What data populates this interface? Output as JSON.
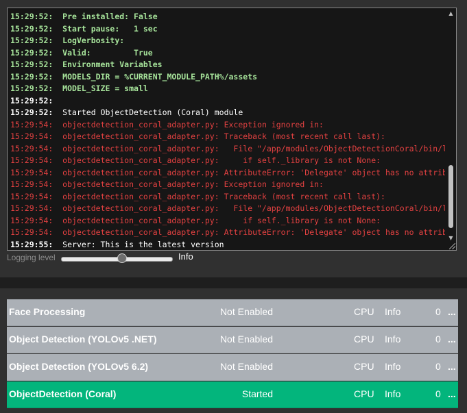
{
  "log": {
    "lines": [
      {
        "time": "15:29:52:",
        "msg": "Pre installed: False",
        "level": "green"
      },
      {
        "time": "15:29:52:",
        "msg": "Start pause:   1 sec",
        "level": "green"
      },
      {
        "time": "15:29:52:",
        "msg": "LogVerbosity:",
        "level": "green"
      },
      {
        "time": "15:29:52:",
        "msg": "Valid:         True",
        "level": "green"
      },
      {
        "time": "15:29:52:",
        "msg": "Environment Variables",
        "level": "green"
      },
      {
        "time": "15:29:52:",
        "msg": "MODELS_DIR = %CURRENT_MODULE_PATH%/assets",
        "level": "green"
      },
      {
        "time": "15:29:52:",
        "msg": "MODEL_SIZE = small",
        "level": "green"
      },
      {
        "time": "15:29:52:",
        "msg": "",
        "level": "white"
      },
      {
        "time": "15:29:52:",
        "msg": "Started ObjectDetection (Coral) module",
        "level": "white"
      },
      {
        "time": "15:29:54:",
        "msg": "objectdetection_coral_adapter.py: Exception ignored in:",
        "level": "red"
      },
      {
        "time": "15:29:54:",
        "msg": "objectdetection_coral_adapter.py: Traceback (most recent call last):",
        "level": "red"
      },
      {
        "time": "15:29:54:",
        "msg": "objectdetection_coral_adapter.py:   File \"/app/modules/ObjectDetectionCoral/bin/linux/py",
        "level": "red"
      },
      {
        "time": "15:29:54:",
        "msg": "objectdetection_coral_adapter.py:     if self._library is not None:",
        "level": "red"
      },
      {
        "time": "15:29:54:",
        "msg": "objectdetection_coral_adapter.py: AttributeError: 'Delegate' object has no attribute '_l",
        "level": "red"
      },
      {
        "time": "15:29:54:",
        "msg": "objectdetection_coral_adapter.py: Exception ignored in:",
        "level": "red"
      },
      {
        "time": "15:29:54:",
        "msg": "objectdetection_coral_adapter.py: Traceback (most recent call last):",
        "level": "red"
      },
      {
        "time": "15:29:54:",
        "msg": "objectdetection_coral_adapter.py:   File \"/app/modules/ObjectDetectionCoral/bin/linux/py",
        "level": "red"
      },
      {
        "time": "15:29:54:",
        "msg": "objectdetection_coral_adapter.py:     if self._library is not None:",
        "level": "red"
      },
      {
        "time": "15:29:54:",
        "msg": "objectdetection_coral_adapter.py: AttributeError: 'Delegate' object has no attribute '_l",
        "level": "red"
      },
      {
        "time": "15:29:55:",
        "msg": "Server: This is the latest version",
        "level": "white"
      }
    ]
  },
  "logging": {
    "label": "Logging level",
    "value": "Info",
    "slider_level": 0.55
  },
  "modules": [
    {
      "name": "Face Processing",
      "status": "Not Enabled",
      "processor": "CPU",
      "log_level": "Info",
      "count": "0",
      "more": "..."
    },
    {
      "name": "Object Detection (YOLOv5 .NET)",
      "status": "Not Enabled",
      "processor": "CPU",
      "log_level": "Info",
      "count": "0",
      "more": "..."
    },
    {
      "name": "Object Detection (YOLOv5 6.2)",
      "status": "Not Enabled",
      "processor": "CPU",
      "log_level": "Info",
      "count": "0",
      "more": "..."
    },
    {
      "name": "ObjectDetection (Coral)",
      "status": "Started",
      "processor": "CPU",
      "log_level": "Info",
      "count": "0",
      "more": "..."
    }
  ],
  "colors": {
    "log_green": "#a7e49b",
    "log_red": "#e34141",
    "started_green": "#03b57c",
    "row_grey": "#abb0b6"
  },
  "icons": {
    "scroll_up": "triangle-up-icon",
    "scroll_down": "triangle-down-icon",
    "resize": "resize-grip-icon"
  }
}
